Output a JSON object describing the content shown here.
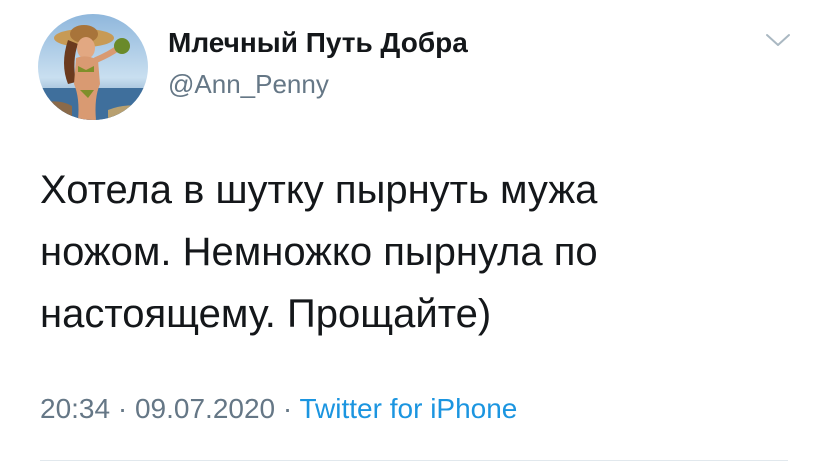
{
  "tweet": {
    "author": {
      "display_name": "Млечный Путь Добра",
      "handle": "@Ann_Penny",
      "avatar_icon": "avatar-image"
    },
    "menu_icon": "chevron-down-icon",
    "text_lines": [
      "Хотела в шутку пырнуть мужа",
      "ножом. Немножко пырнула по",
      "настоящему. Прощайте)"
    ],
    "time": "20:34",
    "separator": "·",
    "date": "09.07.2020",
    "source": "Twitter for iPhone"
  },
  "colors": {
    "text": "#14171a",
    "secondary": "#657786",
    "link": "#1b95e0",
    "divider": "#e1e8ed"
  }
}
